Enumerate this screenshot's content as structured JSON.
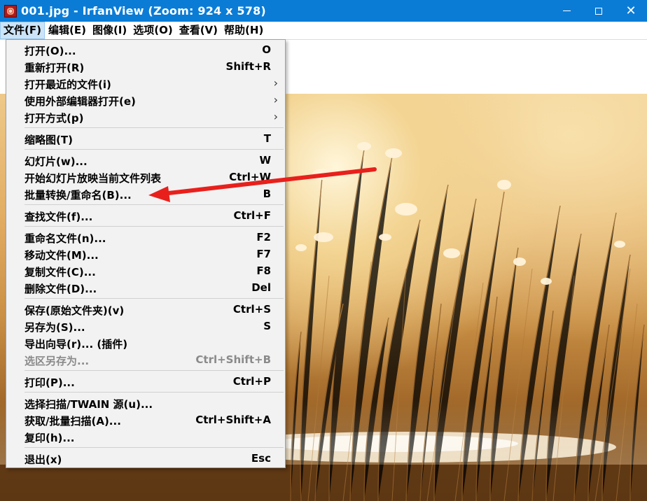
{
  "window": {
    "title": "001.jpg - IrfanView (Zoom: 924 x 578)",
    "icon": "irfanview-icon",
    "minimize": "—",
    "maximize": "☐",
    "close": "✕"
  },
  "menubar": {
    "items": [
      {
        "label": "文件(F)",
        "open": true
      },
      {
        "label": "编辑(E)"
      },
      {
        "label": "图像(I)"
      },
      {
        "label": "选项(O)"
      },
      {
        "label": "查看(V)"
      },
      {
        "label": "帮助(H)"
      }
    ]
  },
  "file_menu": {
    "groups": [
      [
        {
          "label": "打开(O)...",
          "shortcut": "O"
        },
        {
          "label": "重新打开(R)",
          "shortcut": "Shift+R"
        },
        {
          "label": "打开最近的文件(i)",
          "submenu": "›"
        },
        {
          "label": "使用外部编辑器打开(e)",
          "submenu": "›"
        },
        {
          "label": "打开方式(p)",
          "submenu": "›"
        }
      ],
      [
        {
          "label": "缩略图(T)",
          "shortcut": "T"
        }
      ],
      [
        {
          "label": "幻灯片(w)...",
          "shortcut": "W"
        },
        {
          "label": "开始幻灯片放映当前文件列表",
          "shortcut": "Ctrl+W"
        },
        {
          "label": "批量转换/重命名(B)...",
          "shortcut": "B"
        }
      ],
      [
        {
          "label": "查找文件(f)...",
          "shortcut": "Ctrl+F"
        }
      ],
      [
        {
          "label": "重命名文件(n)...",
          "shortcut": "F2"
        },
        {
          "label": "移动文件(M)...",
          "shortcut": "F7"
        },
        {
          "label": "复制文件(C)...",
          "shortcut": "F8"
        },
        {
          "label": "删除文件(D)...",
          "shortcut": "Del"
        }
      ],
      [
        {
          "label": "保存(原始文件夹)(v)",
          "shortcut": "Ctrl+S"
        },
        {
          "label": "另存为(S)...",
          "shortcut": "S"
        },
        {
          "label": "导出向导(r)... (插件)",
          "shortcut": ""
        },
        {
          "label": "选区另存为...",
          "shortcut": "Ctrl+Shift+B",
          "disabled": true
        }
      ],
      [
        {
          "label": "打印(P)...",
          "shortcut": "Ctrl+P"
        }
      ],
      [
        {
          "label": "选择扫描/TWAIN 源(u)...",
          "shortcut": ""
        },
        {
          "label": "获取/批量扫描(A)...",
          "shortcut": "Ctrl+Shift+A"
        },
        {
          "label": "复印(h)...",
          "shortcut": ""
        }
      ],
      [
        {
          "label": "退出(x)",
          "shortcut": "Esc"
        }
      ]
    ]
  },
  "annotation": {
    "color": "#e8201c",
    "points_to": "批量转换/重命名(B)..."
  },
  "colors": {
    "titlebar": "#0a7cd6",
    "menu_open": "#cce4f7",
    "menu_bg": "#f2f2f2"
  }
}
